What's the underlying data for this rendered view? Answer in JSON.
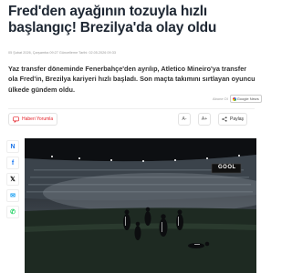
{
  "article": {
    "headline": "Fred'den ayağının tozuyla hızlı başlangıç! Brezilya'da olay oldu",
    "meta": "05 Şubat 2026, Çarşamba 09:27  Güncelleme Tarihi: 02.05.2026 09:33",
    "summary": "Yaz transfer döneminde Fenerbahçe'den ayrılıp, Atletico Mineiro'ya transfer ola Fred'in, Brezilya kariyeri hızlı başladı. Son maçta takımını sırtlayan oyuncu ülkede gündem oldu.",
    "source_label": "Abone Ol",
    "source_badge": "Google News"
  },
  "toolbar": {
    "comment_label": "Haberi Yorumla",
    "font_decrease": "A-",
    "font_increase": "A+",
    "share_label": "Paylaş"
  },
  "social": {
    "icons": [
      "google-news-icon",
      "facebook-icon",
      "x-icon",
      "mail-icon",
      "whatsapp-icon"
    ],
    "glyphs": [
      "N",
      "f",
      "𝕏",
      "✉",
      "✆"
    ]
  },
  "photo": {
    "scoreboard_text": "GOOL"
  },
  "colors": {
    "accent": "#e5222a",
    "headline": "#1e2733",
    "facebook": "#1877f2",
    "whatsapp": "#25d366"
  }
}
